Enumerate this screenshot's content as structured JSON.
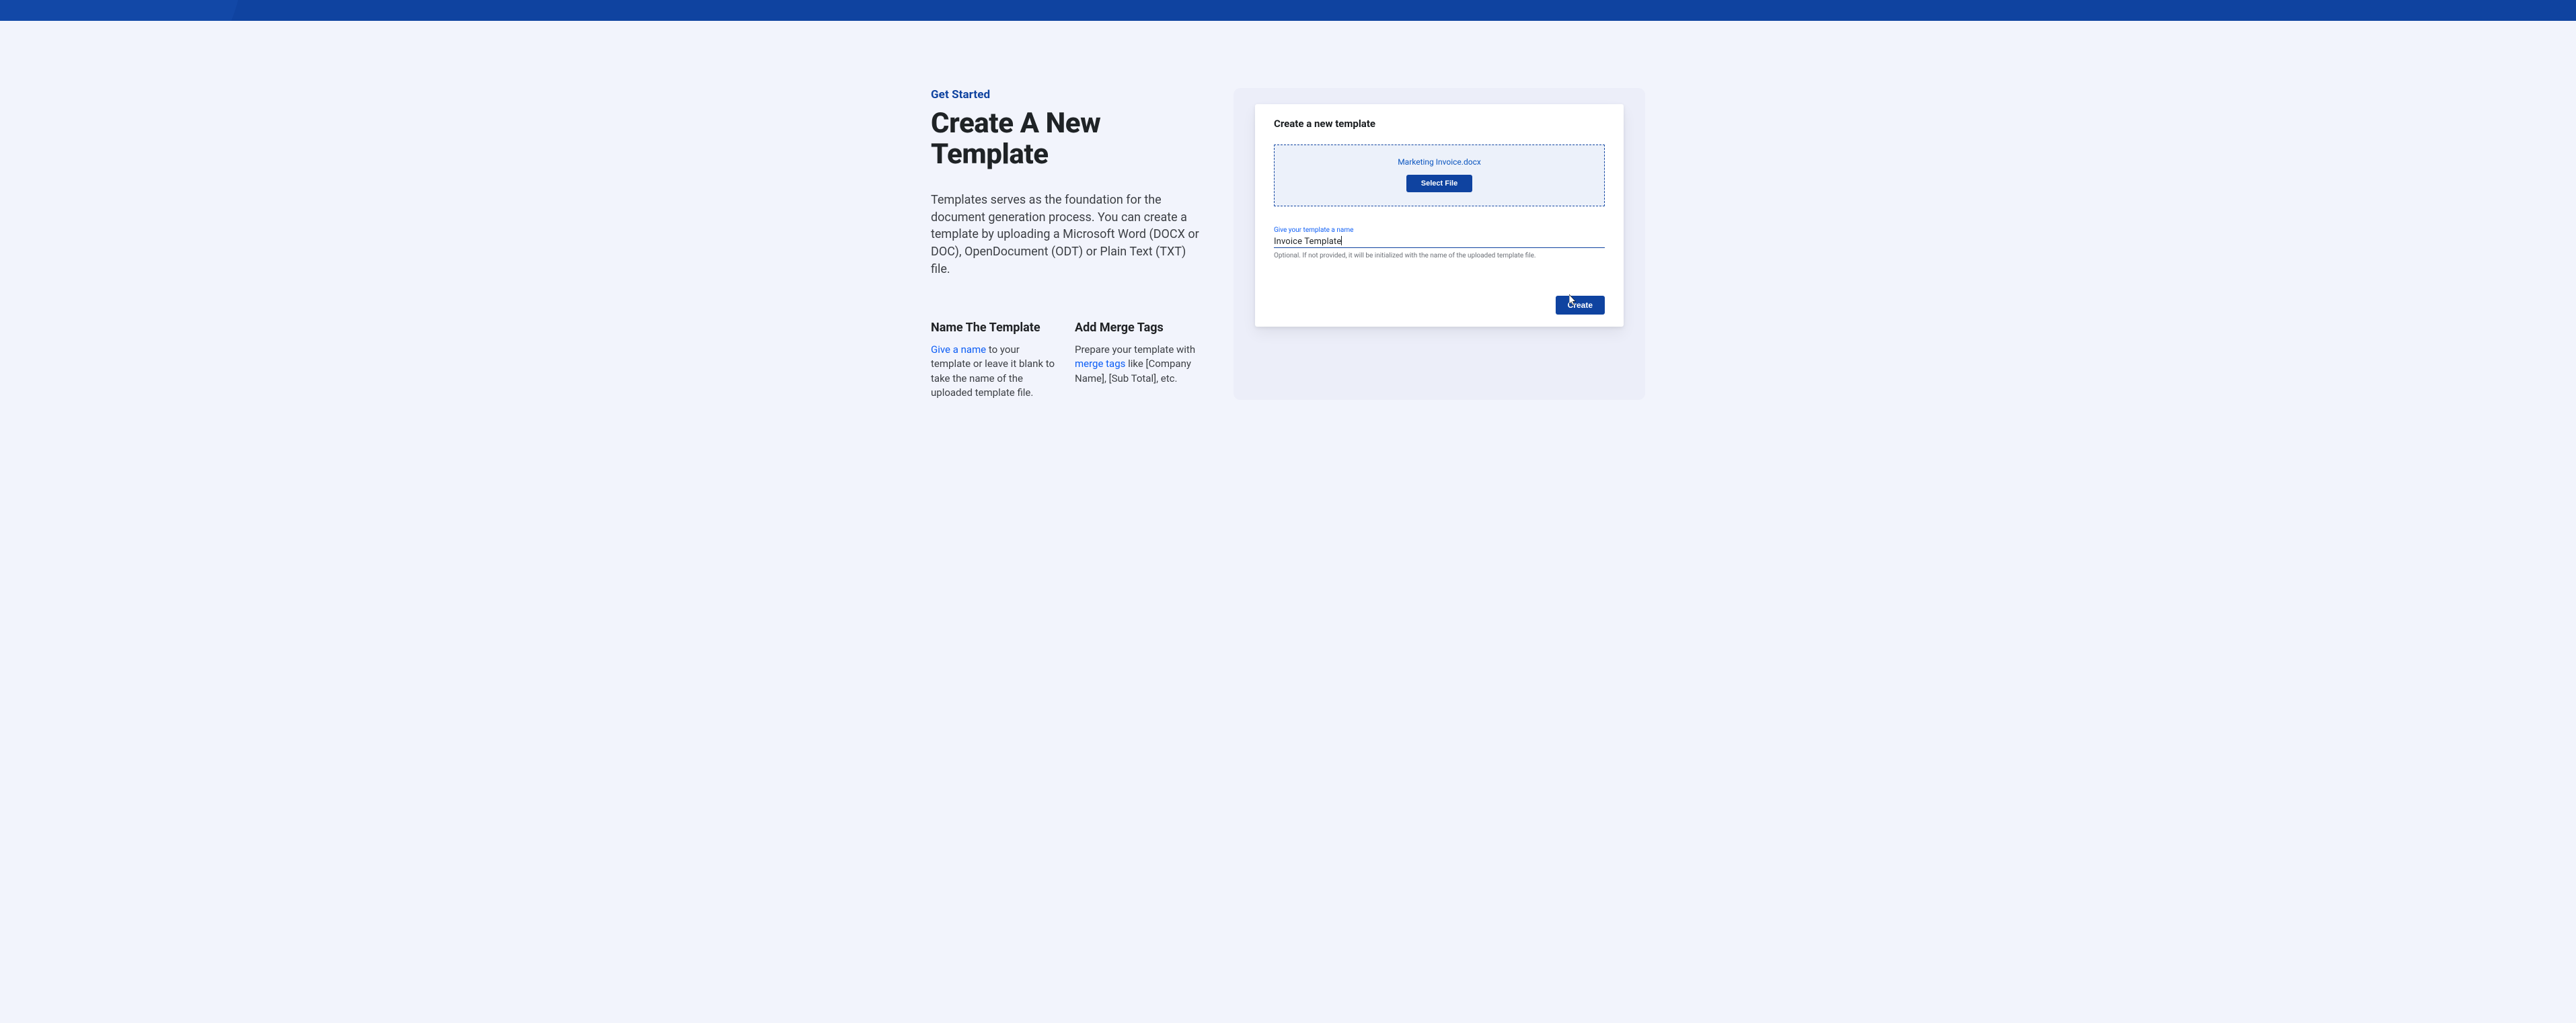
{
  "eyebrow": "Get Started",
  "heading": "Create A New Template",
  "lead": "Templates serves as the foundation for the document generation process. You can create a template by uploading a Microsoft Word (DOCX or DOC), OpenDocument (ODT) or Plain Text (TXT) file.",
  "sub": {
    "name": {
      "title": "Name The Template",
      "link": "Give a name",
      "rest": " to your template or leave it blank to take the name of the uploaded template file."
    },
    "tags": {
      "title": "Add Merge Tags",
      "pre": "Prepare your template with ",
      "link": "merge tags",
      "rest": " like [Company Name], [Sub Total], etc."
    }
  },
  "panel": {
    "title": "Create a new template",
    "drop": {
      "filename": "Marketing Invoice.docx",
      "selectFile": "Select File"
    },
    "field": {
      "label": "Give your template a name",
      "value": "Invoice Template",
      "helper": "Optional. If not provided, it will be initialized with the name of the uploaded template file."
    },
    "create": "Create"
  }
}
